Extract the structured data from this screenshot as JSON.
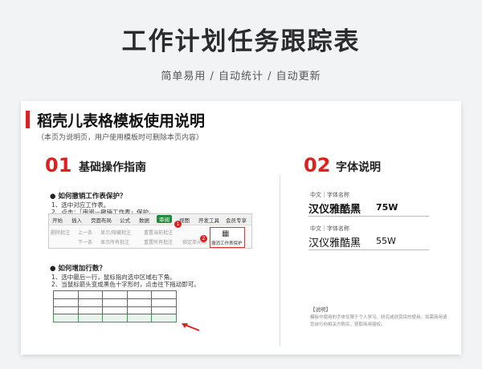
{
  "header": {
    "title": "工作计划任务跟踪表",
    "subtitle": "简单易用  /  自动统计  /  自动更新"
  },
  "sheet": {
    "title": "稻壳儿表格模板使用说明",
    "note": "（本页为说明页，用户使用模板时可删除本页内容）",
    "section1": {
      "num": "01",
      "label": "基础操作指南",
      "q1": "●  如何撤销工作表保护？",
      "q1_steps": [
        "1、选中对应工作表。",
        "2、点击：「审阅—撤销工作表」保护。"
      ],
      "ribbon_tabs": [
        "开始",
        "插入",
        "页面布局",
        "公式",
        "数据",
        "审阅",
        "视图",
        "开发工具",
        "会员专享"
      ],
      "ribbon_buttons": [
        "删除批注",
        "上一条",
        "显示/隐藏批注",
        "重置当前批注",
        "下一条",
        "显示所有批注",
        "重置所有批注",
        "锁定单元格"
      ],
      "protect_label": "撤消工作表保护",
      "badge1": "1",
      "badge2": "2",
      "q2": "●  如何增加行数？",
      "q2_steps": [
        "1、选中最后一行，鼠标指向选中区域右下角。",
        "2、当鼠标箭头变成黑色十字形时，点击往下拖动即可。"
      ]
    },
    "section2": {
      "num": "02",
      "label": "字体说明",
      "fonts": [
        {
          "caption": "中文｜字体名称",
          "name": "汉仪雅酷黑",
          "weight": "75W"
        },
        {
          "caption": "中文｜字体名称",
          "name": "汉仪雅酷黑",
          "weight": "55W"
        }
      ],
      "note_title": "【说明】",
      "note_text": "模板中使用的字体仅限于个人学习、研究或欣赏目的使用。如需商用请您自行向相关方购买，获取商用授权。"
    }
  }
}
